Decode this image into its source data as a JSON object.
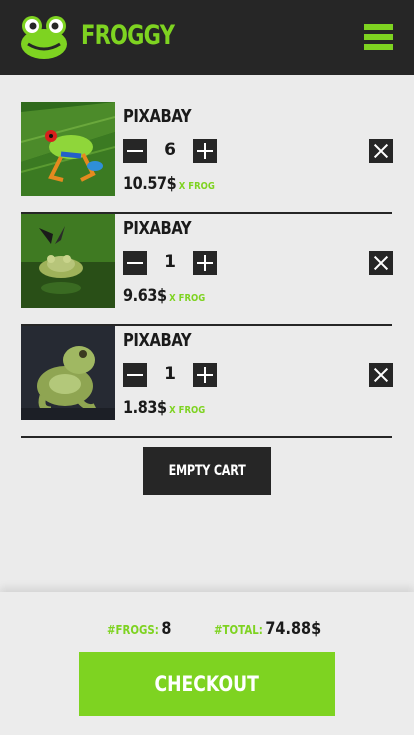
{
  "brand": {
    "name": "FROGGY"
  },
  "cart": {
    "items": [
      {
        "title": "PIXABAY",
        "quantity": "6",
        "price": "10.57$",
        "unit": "X FROG",
        "image": "red-eyed-tree-frog"
      },
      {
        "title": "PIXABAY",
        "quantity": "1",
        "price": "9.63$",
        "unit": "X FROG",
        "image": "frog-with-butterfly"
      },
      {
        "title": "PIXABAY",
        "quantity": "1",
        "price": "1.83$",
        "unit": "X FROG",
        "image": "green-tree-frog"
      }
    ],
    "empty_label": "EMPTY CART"
  },
  "summary": {
    "frogs_label": "#FROGS:",
    "frogs_value": "8",
    "total_label": "#TOTAL:",
    "total_value": "74.88$",
    "checkout_label": "CHECKOUT"
  },
  "colors": {
    "accent": "#7ed321",
    "dark": "#262626",
    "background": "#ebebeb"
  }
}
